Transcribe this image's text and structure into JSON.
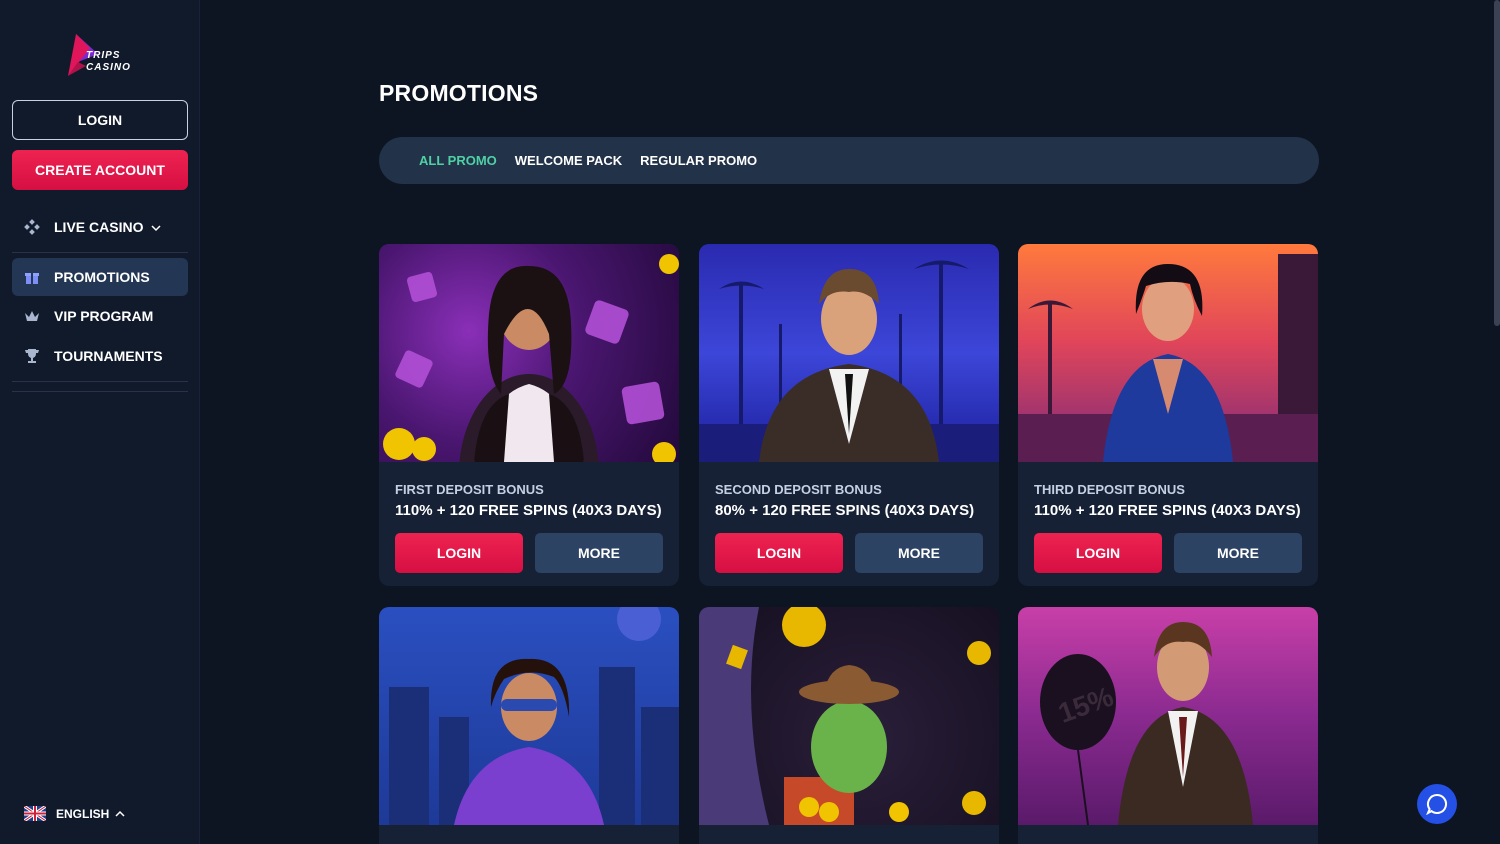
{
  "brand": {
    "logo_line1": "TRIPS",
    "logo_line2": "CASINO"
  },
  "sidebar": {
    "login_label": "LOGIN",
    "create_account_label": "CREATE ACCOUNT",
    "items": [
      {
        "label": "LIVE CASINO",
        "icon": "dice-icon"
      },
      {
        "label": "PROMOTIONS",
        "icon": "gift-icon",
        "active": true
      },
      {
        "label": "VIP PROGRAM",
        "icon": "crown-icon"
      },
      {
        "label": "TOURNAMENTS",
        "icon": "trophy-icon"
      }
    ],
    "language": "ENGLISH"
  },
  "main": {
    "title": "PROMOTIONS",
    "tabs": [
      {
        "label": "ALL PROMO",
        "active": true
      },
      {
        "label": "WELCOME PACK"
      },
      {
        "label": "REGULAR PROMO"
      }
    ],
    "cards": [
      {
        "kicker": "FIRST DEPOSIT BONUS",
        "offer": "110% + 120 FREE SPINS (40X3 DAYS)",
        "login": "LOGIN",
        "more": "MORE"
      },
      {
        "kicker": "SECOND DEPOSIT BONUS",
        "offer": "80% + 120 FREE SPINS (40X3 DAYS)",
        "login": "LOGIN",
        "more": "MORE"
      },
      {
        "kicker": "THIRD DEPOSIT BONUS",
        "offer": "110% + 120 FREE SPINS (40X3 DAYS)",
        "login": "LOGIN",
        "more": "MORE"
      }
    ],
    "balloon_text": "15%"
  },
  "colors": {
    "accent_red": "#e8174a",
    "active_tab": "#4fd1a5",
    "bg": "#0d1422",
    "chat": "#2450e6"
  }
}
